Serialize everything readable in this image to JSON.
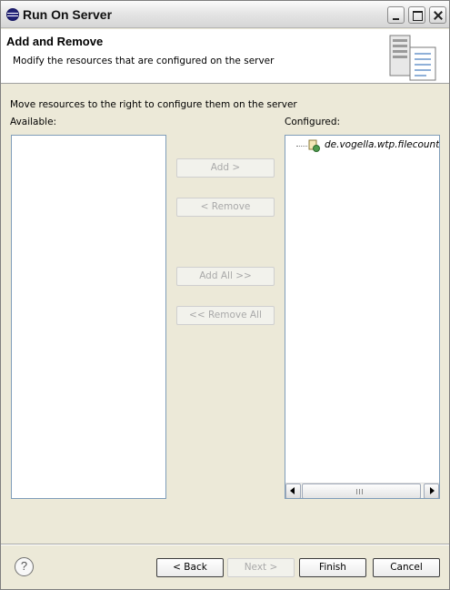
{
  "window": {
    "title": "Run On Server"
  },
  "banner": {
    "title": "Add and Remove",
    "description": "Modify the resources that are configured on the server"
  },
  "instructions": "Move resources to the right to configure them on the server",
  "available": {
    "label": "Available:",
    "items": []
  },
  "configured": {
    "label": "Configured:",
    "items": [
      {
        "label": "de.vogella.wtp.filecounte",
        "icon": "web-project-icon"
      }
    ]
  },
  "transfer_buttons": {
    "add": "Add >",
    "remove": "< Remove",
    "add_all": "Add All >>",
    "remove_all": "<< Remove All"
  },
  "footer": {
    "help": "?",
    "back": "< Back",
    "next": "Next >",
    "finish": "Finish",
    "cancel": "Cancel"
  },
  "colors": {
    "dialog_bg": "#ece9d8",
    "list_border": "#7f9db9",
    "disabled_text": "#a9a9a9"
  }
}
